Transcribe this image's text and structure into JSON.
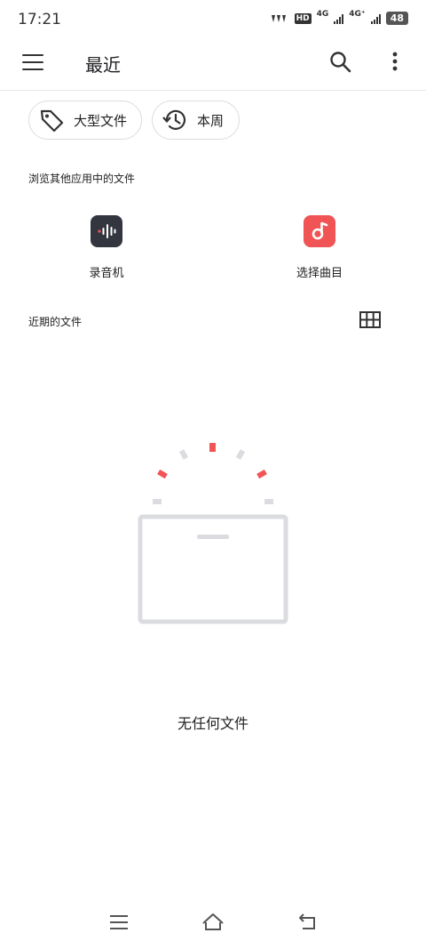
{
  "status_bar": {
    "time": "17:21",
    "hd_label": "HD",
    "network_1": "4G",
    "network_2": "4G⁺",
    "battery": "48"
  },
  "app_bar": {
    "title": "最近",
    "menu_icon": "menu-icon",
    "search_icon": "search-icon",
    "more_icon": "more-vert-icon"
  },
  "chips": [
    {
      "label": "大型文件",
      "icon": "tag-icon"
    },
    {
      "label": "本周",
      "icon": "history-icon"
    }
  ],
  "browse_section": {
    "label": "浏览其他应用中的文件",
    "apps": [
      {
        "label": "录音机",
        "icon": "recorder-icon"
      },
      {
        "label": "选择曲目",
        "icon": "music-icon"
      }
    ]
  },
  "recent_section": {
    "label": "近期的文件",
    "view_icon": "grid-view-icon"
  },
  "empty_state": {
    "text": "无任何文件"
  },
  "colors": {
    "accent_red": "#f05454",
    "recorder_bg": "#33363f",
    "illustration_gray": "#dadce0"
  }
}
